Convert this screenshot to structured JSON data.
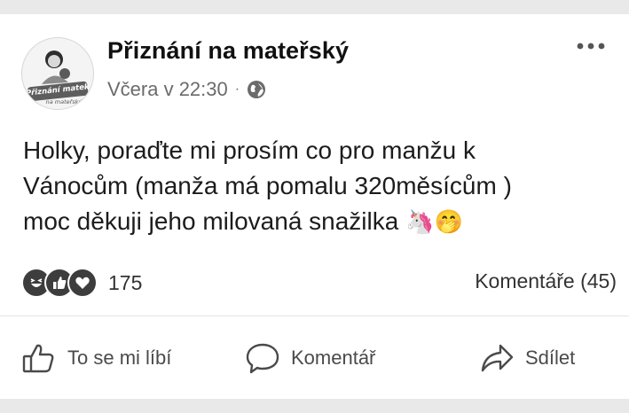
{
  "post": {
    "page_name": "Přiznání na mateřský",
    "timestamp": "Včera v 22:30",
    "separator": "·",
    "audience_icon": "globe-icon",
    "text_lines": [
      "Holky, poraďte mi prosím co pro manžu k",
      "Vánocům (manža má pomalu 320měsícům )",
      "moc děkuji jeho milovaná snažilka"
    ],
    "emojis": [
      "🦄",
      "🤭"
    ],
    "logo_text": [
      "Přiznání matek",
      "na mateřský"
    ]
  },
  "reactions": {
    "icons": [
      "haha-icon",
      "like-icon",
      "love-icon"
    ],
    "count": "175"
  },
  "comments": {
    "label": "Komentáře (45)"
  },
  "actions": {
    "like_label": "To se mi líbí",
    "comment_label": "Komentář",
    "share_label": "Sdílet"
  }
}
